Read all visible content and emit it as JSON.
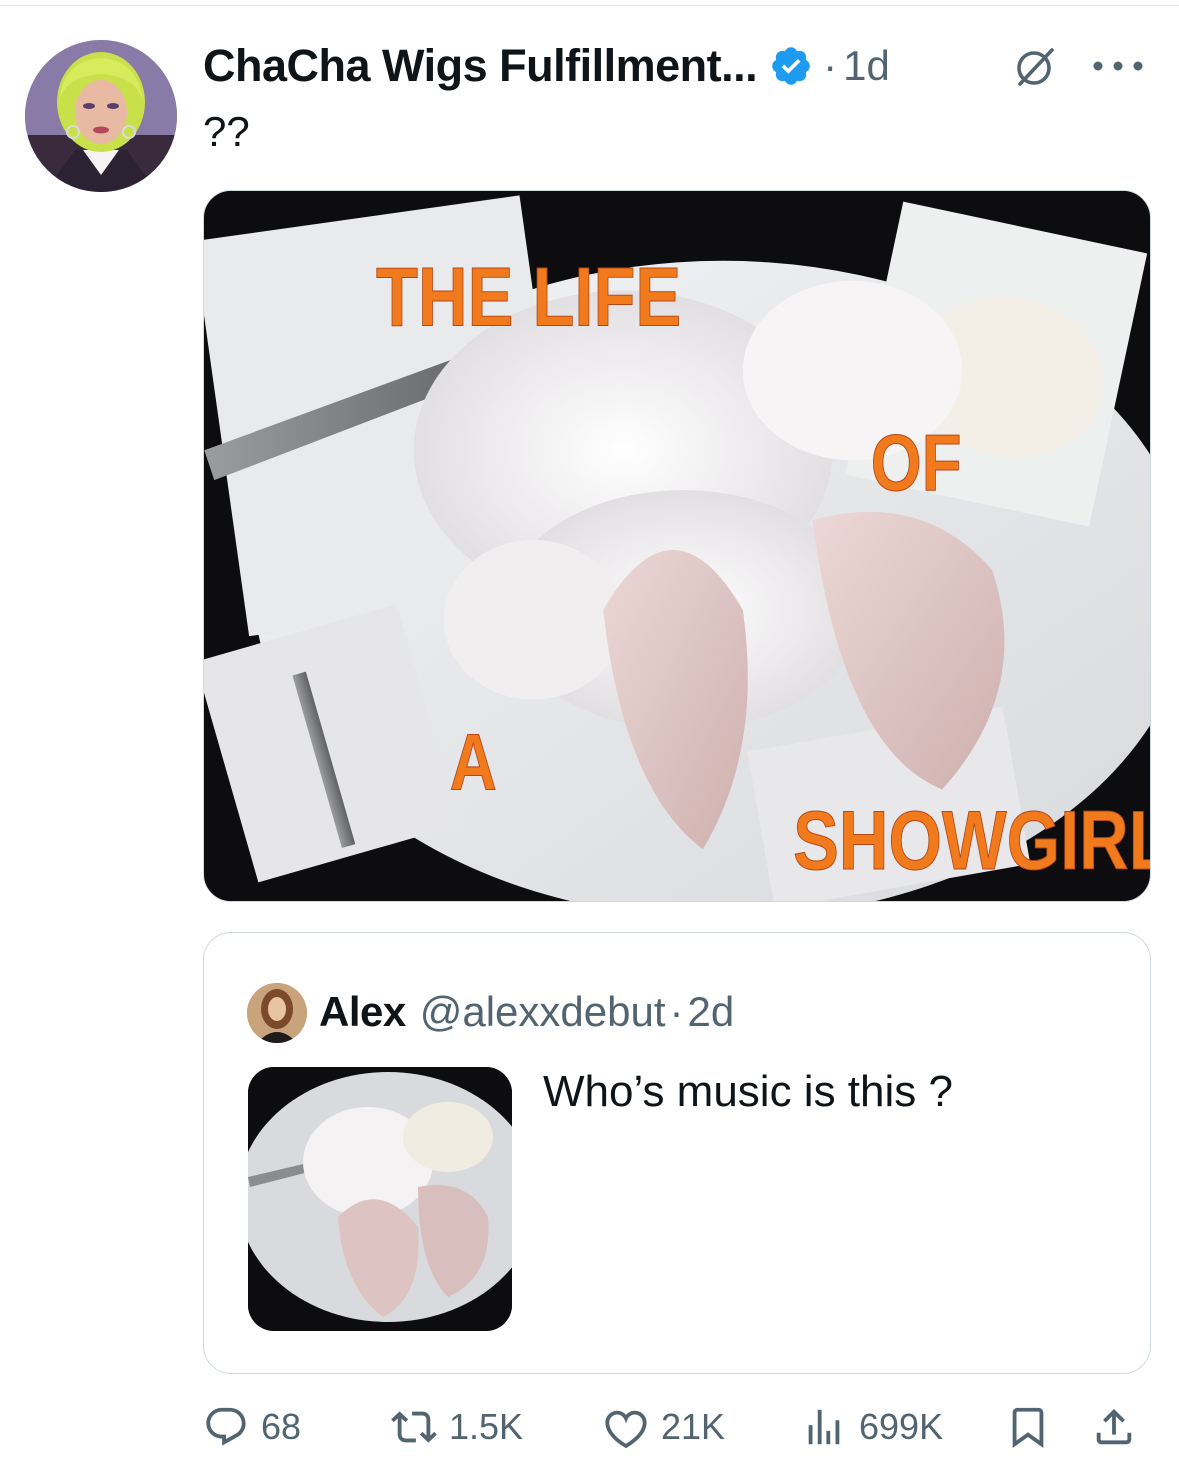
{
  "post": {
    "author_name": "ChaCha Wigs Fulfillment...",
    "verified": true,
    "separator": "·",
    "time": "1d",
    "text": "??",
    "icons": {
      "grok": "grok-slash-icon",
      "more": "more-dots-icon",
      "verified": "verified-badge-icon"
    },
    "media": {
      "overlay_text": {
        "line1": "THE LIFE",
        "line2": "OF",
        "line3": "A",
        "line4": "SHOWGIRL"
      }
    }
  },
  "quote": {
    "author_name": "Alex",
    "handle": "@alexxdebut",
    "separator": "·",
    "time": "2d",
    "text": "Who’s music is this ?"
  },
  "actions": {
    "replies": "68",
    "reposts": "1.5K",
    "likes": "21K",
    "views": "699K",
    "icons": [
      "reply-icon",
      "repost-icon",
      "like-icon",
      "views-icon",
      "bookmark-icon",
      "share-icon"
    ]
  },
  "colors": {
    "verified_blue": "#1d9bf0",
    "secondary_text": "#536471",
    "overlay_orange": "#f07a1c",
    "border": "#cfd9de"
  }
}
